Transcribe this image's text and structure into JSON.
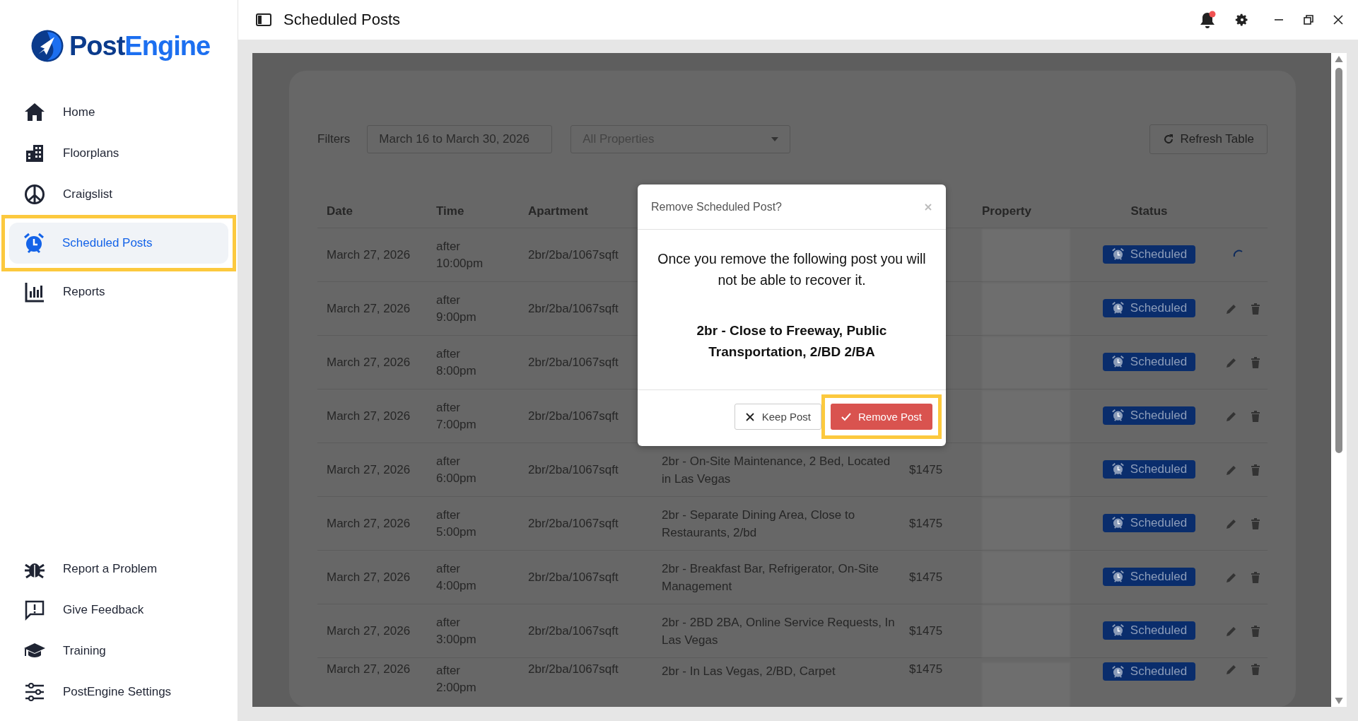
{
  "logo": {
    "parts": [
      "Post",
      "Engine"
    ]
  },
  "sidebar": {
    "items": [
      {
        "label": "Home",
        "selected": false,
        "highlighted": false
      },
      {
        "label": "Floorplans",
        "selected": false,
        "highlighted": false
      },
      {
        "label": "Craigslist",
        "selected": false,
        "highlighted": false
      },
      {
        "label": "Scheduled Posts",
        "selected": true,
        "highlighted": true
      },
      {
        "label": "Reports",
        "selected": false,
        "highlighted": false
      }
    ],
    "bottom_items": [
      {
        "label": "Report a Problem"
      },
      {
        "label": "Give Feedback"
      },
      {
        "label": "Training"
      },
      {
        "label": "PostEngine Settings"
      }
    ]
  },
  "header": {
    "title": "Scheduled Posts",
    "notification": true
  },
  "filters": {
    "label": "Filters",
    "date_range": "March 16 to March 30, 2026",
    "property": {
      "placeholder": "All Properties"
    },
    "refresh": "Refresh Table"
  },
  "table": {
    "columns": [
      "Date",
      "Time",
      "Apartment",
      null,
      null,
      "Property",
      "Status"
    ],
    "rows": [
      {
        "date": "March 27, 2026",
        "time": "after 10:00pm",
        "apartment": "2br/2ba/1067sqft",
        "status": "Scheduled",
        "busy": true
      },
      {
        "date": "March 27, 2026",
        "time": "after 9:00pm",
        "apartment": "2br/2ba/1067sqft",
        "status": "Scheduled",
        "busy": false
      },
      {
        "date": "March 27, 2026",
        "time": "after 8:00pm",
        "apartment": "2br/2ba/1067sqft",
        "status": "Scheduled",
        "busy": false
      },
      {
        "date": "March 27, 2026",
        "time": "after 7:00pm",
        "apartment": "2br/2ba/1067sqft",
        "status": "Scheduled",
        "busy": false
      },
      {
        "date": "March 27, 2026",
        "time": "after 6:00pm",
        "apartment": "2br/2ba/1067sqft",
        "title": "2br - On-Site Maintenance, 2 Bed, Located in Las Vegas",
        "price": "$1475",
        "status": "Scheduled",
        "busy": false
      },
      {
        "date": "March 27, 2026",
        "time": "after 5:00pm",
        "apartment": "2br/2ba/1067sqft",
        "title": "2br - Separate Dining Area, Close to Restaurants, 2/bd",
        "price": "$1475",
        "status": "Scheduled",
        "busy": false
      },
      {
        "date": "March 27, 2026",
        "time": "after 4:00pm",
        "apartment": "2br/2ba/1067sqft",
        "title": "2br - Breakfast Bar, Refrigerator, On-Site Management",
        "price": "$1475",
        "status": "Scheduled",
        "busy": false
      },
      {
        "date": "March 27, 2026",
        "time": "after 3:00pm",
        "apartment": "2br/2ba/1067sqft",
        "title": "2br - 2BD 2BA, Online Service Requests, In Las Vegas",
        "price": "$1475",
        "status": "Scheduled",
        "busy": false
      },
      {
        "date": "March 27, 2026",
        "time": "after 2:00pm",
        "apartment": "2br/2ba/1067sqft",
        "title": "2br - In Las Vegas, 2/BD, Carpet",
        "price": "$1475",
        "status": "Scheduled",
        "busy": false
      }
    ]
  },
  "dialog": {
    "title": "Remove Scheduled Post?",
    "message": "Once you remove the following post you will not be able to recover it.",
    "post_title": "2br - Close to Freeway, Public Transportation, 2/BD 2/BA",
    "buttons": [
      {
        "label": "Keep Post",
        "kind": "secondary",
        "highlighted": false
      },
      {
        "label": "Remove Post",
        "kind": "danger",
        "highlighted": true
      }
    ]
  }
}
